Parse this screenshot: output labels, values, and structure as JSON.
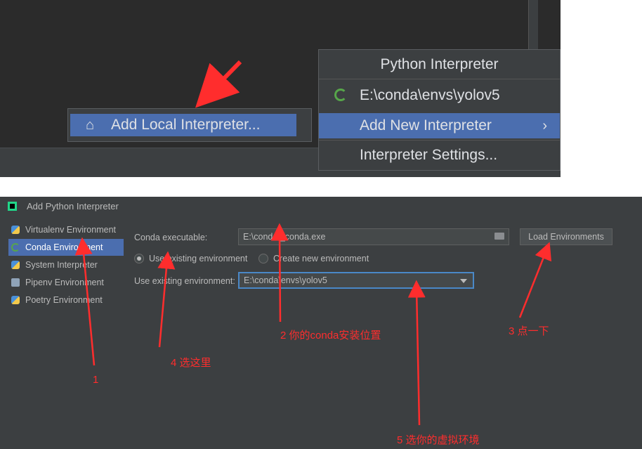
{
  "top_panel": {
    "add_local_interpreter_label": "Add Local Interpreter...",
    "home_icon": "home-icon",
    "menu": {
      "title": "Python Interpreter",
      "env_label": "E:\\conda\\envs\\yolov5",
      "add_new_label": "Add New Interpreter",
      "add_new_chevron": "›",
      "settings_label": "Interpreter Settings..."
    }
  },
  "dialog": {
    "title": "Add Python Interpreter",
    "sidebar": [
      {
        "label": "Virtualenv Environment",
        "icon": "python-icon",
        "selected": false
      },
      {
        "label": "Conda Environment",
        "icon": "conda-icon",
        "selected": true
      },
      {
        "label": "System Interpreter",
        "icon": "python-icon",
        "selected": false
      },
      {
        "label": "Pipenv Environment",
        "icon": "pipenv-icon",
        "selected": false
      },
      {
        "label": "Poetry Environment",
        "icon": "python-icon",
        "selected": false
      }
    ],
    "conda_exe_label": "Conda executable:",
    "conda_exe_value": "E:\\conda\\_conda.exe",
    "load_env_button": "Load Environments",
    "radio_existing_label": "Use existing environment",
    "radio_new_label": "Create new environment",
    "existing_env_label": "Use existing environment:",
    "existing_env_value": "E:\\conda\\envs\\yolov5"
  },
  "annotations": {
    "note_1": "1",
    "note_2": "2 你的conda安装位置",
    "note_3": "3 点一下",
    "note_4": "4 选这里",
    "note_5": "5 选你的虚拟环境",
    "color": "#ff2d2d"
  },
  "colors": {
    "selection_blue": "#4b6eaf",
    "dark_bg": "#2b2b2b",
    "panel_bg": "#3c3f41",
    "focus_border": "#4a88c7",
    "conda_green": "#57a64a"
  }
}
